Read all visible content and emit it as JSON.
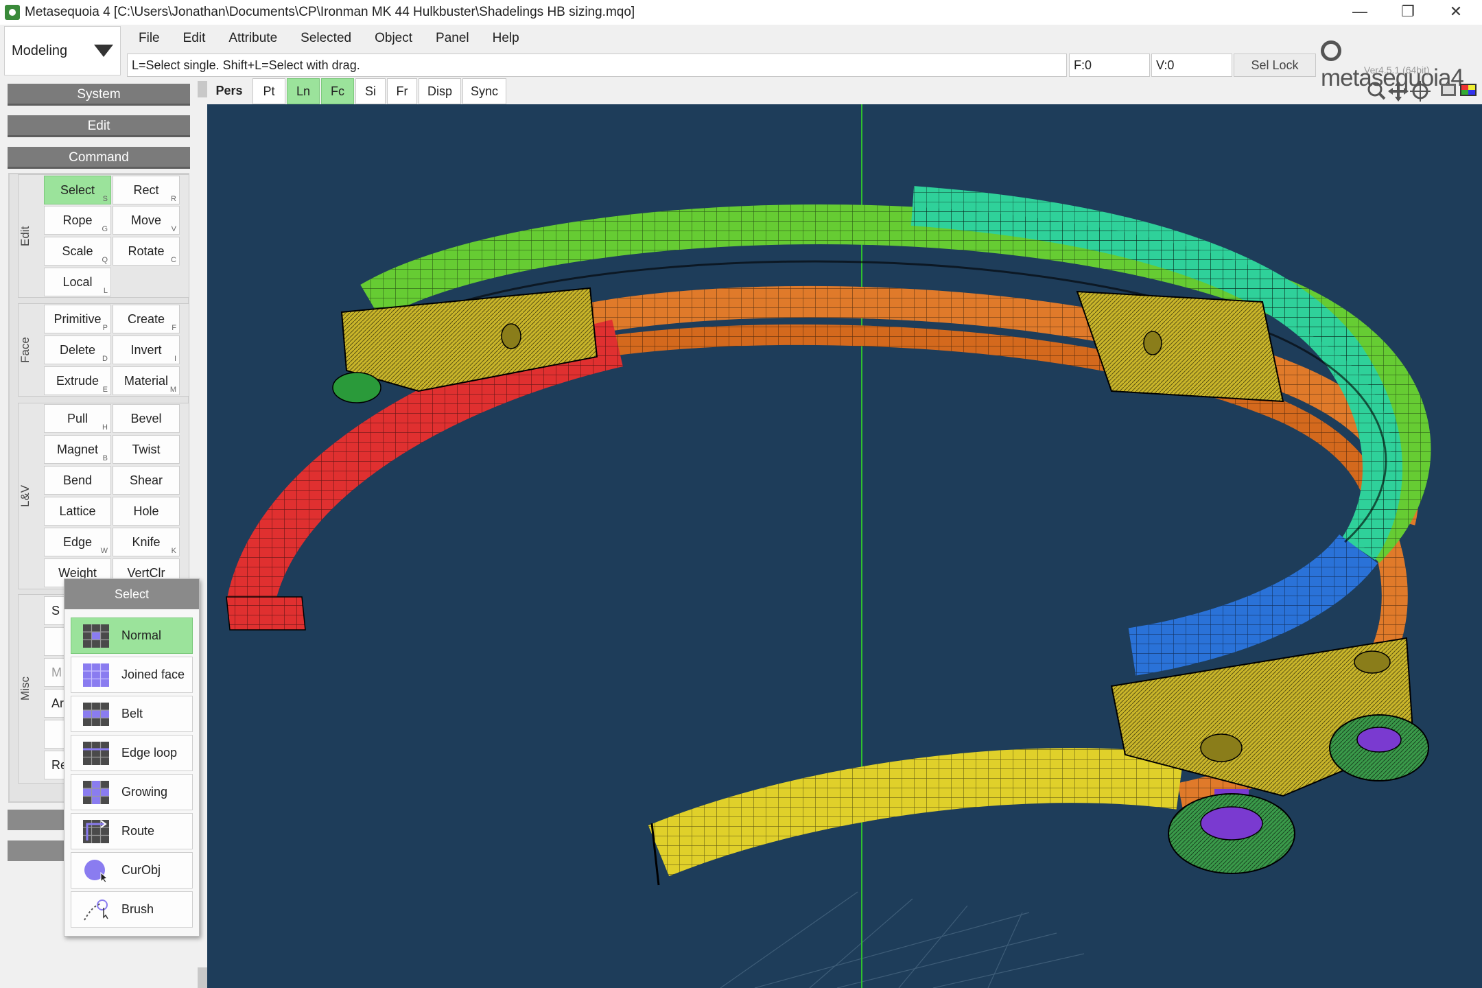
{
  "window": {
    "title": "Metasequoia 4 [C:\\Users\\Jonathan\\Documents\\CP\\Ironman MK 44 Hulkbuster\\Shadelings HB sizing.mqo]",
    "minimize": "—",
    "maximize": "❐",
    "close": "✕"
  },
  "mode": {
    "value": "Modeling"
  },
  "menu": [
    "File",
    "Edit",
    "Attribute",
    "Selected",
    "Object",
    "Panel",
    "Help"
  ],
  "statusbar": {
    "hint": "L=Select single.  Shift+L=Select with drag.",
    "faces": "F:0",
    "vertices": "V:0",
    "sel_lock": "Sel Lock"
  },
  "logo": {
    "name": "metasequoia",
    "number": "4",
    "version": "Ver4.5.1 (64bit)"
  },
  "sidebar": {
    "system": "System",
    "edit": "Edit",
    "command": "Command",
    "groups": {
      "edit": "Edit",
      "face": "Face",
      "lv": "L&V",
      "misc": "Misc"
    },
    "commands": {
      "select": {
        "label": "Select",
        "key": "S"
      },
      "rect": {
        "label": "Rect",
        "key": "R"
      },
      "rope": {
        "label": "Rope",
        "key": "G"
      },
      "move": {
        "label": "Move",
        "key": "V"
      },
      "scale": {
        "label": "Scale",
        "key": "Q"
      },
      "rotate": {
        "label": "Rotate",
        "key": "C"
      },
      "local": {
        "label": "Local",
        "key": "L"
      },
      "primitive": {
        "label": "Primitive",
        "key": "P"
      },
      "create": {
        "label": "Create",
        "key": "F"
      },
      "delete": {
        "label": "Delete",
        "key": "D"
      },
      "invert": {
        "label": "Invert",
        "key": "I"
      },
      "extrude": {
        "label": "Extrude",
        "key": "E"
      },
      "material": {
        "label": "Material",
        "key": "M"
      },
      "pull": {
        "label": "Pull",
        "key": "H"
      },
      "bevel": {
        "label": "Bevel",
        "key": ""
      },
      "magnet": {
        "label": "Magnet",
        "key": "B"
      },
      "twist": {
        "label": "Twist",
        "key": ""
      },
      "bend": {
        "label": "Bend",
        "key": ""
      },
      "shear": {
        "label": "Shear",
        "key": ""
      },
      "lattice": {
        "label": "Lattice",
        "key": ""
      },
      "hole": {
        "label": "Hole",
        "key": ""
      },
      "edge": {
        "label": "Edge",
        "key": "W"
      },
      "knife": {
        "label": "Knife",
        "key": "K"
      },
      "weight": {
        "label": "Weight",
        "key": ""
      },
      "vertclr": {
        "label": "VertClr",
        "key": ""
      }
    },
    "misc_stubs": [
      "S",
      "",
      "M",
      "Ar",
      "",
      "Rer"
    ]
  },
  "popup": {
    "title": "Select",
    "items": [
      "Normal",
      "Joined face",
      "Belt",
      "Edge loop",
      "Growing",
      "Route",
      "CurObj",
      "Brush"
    ],
    "active": "Normal"
  },
  "view_tabs": [
    "Pers",
    "Pt",
    "Ln",
    "Fc",
    "Si",
    "Fr",
    "Disp",
    "Sync"
  ],
  "view_tabs_on": [
    "Ln",
    "Fc"
  ],
  "colors": {
    "viewport_bg": "#1e3d5a",
    "active_green": "#9be39b",
    "ring_red": "#e03030",
    "ring_orange": "#e07a2a",
    "ring_yellow": "#e0d02a",
    "ring_green": "#66cc33",
    "ring_cyan": "#2fd19a",
    "ring_blue": "#2a72d8",
    "bracket_olive": "#c9b52a",
    "axis_green": "#2fbf2f"
  }
}
